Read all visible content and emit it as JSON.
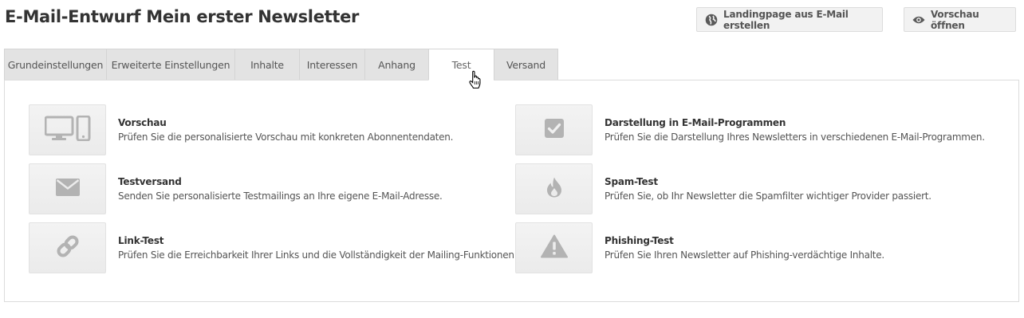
{
  "header": {
    "title": "E-Mail-Entwurf Mein erster Newsletter",
    "buttons": [
      {
        "label": "Landingpage aus E-Mail erstellen",
        "icon": "globe-icon"
      },
      {
        "label": "Vorschau öffnen",
        "icon": "eye-icon"
      }
    ]
  },
  "tabs": [
    {
      "label": "Grundeinstellungen"
    },
    {
      "label": "Erweiterte Einstellungen"
    },
    {
      "label": "Inhalte"
    },
    {
      "label": "Interessen"
    },
    {
      "label": "Anhang"
    },
    {
      "label": "Test",
      "active": true
    },
    {
      "label": "Versand"
    }
  ],
  "items": [
    {
      "title": "Vorschau",
      "desc": "Prüfen Sie die personalisierte Vorschau mit konkreten Abonnentendaten.",
      "icon": "devices-icon"
    },
    {
      "title": "Darstellung in E-Mail-Programmen",
      "desc": "Prüfen Sie die Darstellung Ihres Newsletters in verschiedenen E-Mail-Programmen.",
      "icon": "check-square-icon"
    },
    {
      "title": "Testversand",
      "desc": "Senden Sie personalisierte Testmailings an Ihre eigene E-Mail-Adresse.",
      "icon": "envelope-icon"
    },
    {
      "title": "Spam-Test",
      "desc": "Prüfen Sie, ob Ihr Newsletter die Spamfilter wichtiger Provider passiert.",
      "icon": "flame-icon"
    },
    {
      "title": "Link-Test",
      "desc": "Prüfen Sie die Erreichbarkeit Ihrer Links und die Vollständigkeit der Mailing-Funktionen.",
      "icon": "link-icon"
    },
    {
      "title": "Phishing-Test",
      "desc": "Prüfen Sie Ihren Newsletter auf Phishing-verdächtige Inhalte.",
      "icon": "warning-icon"
    }
  ],
  "colors": {
    "icon": "#b3b3b3",
    "tab_bg": "#e3e3e3",
    "border": "#dcdcdc"
  }
}
